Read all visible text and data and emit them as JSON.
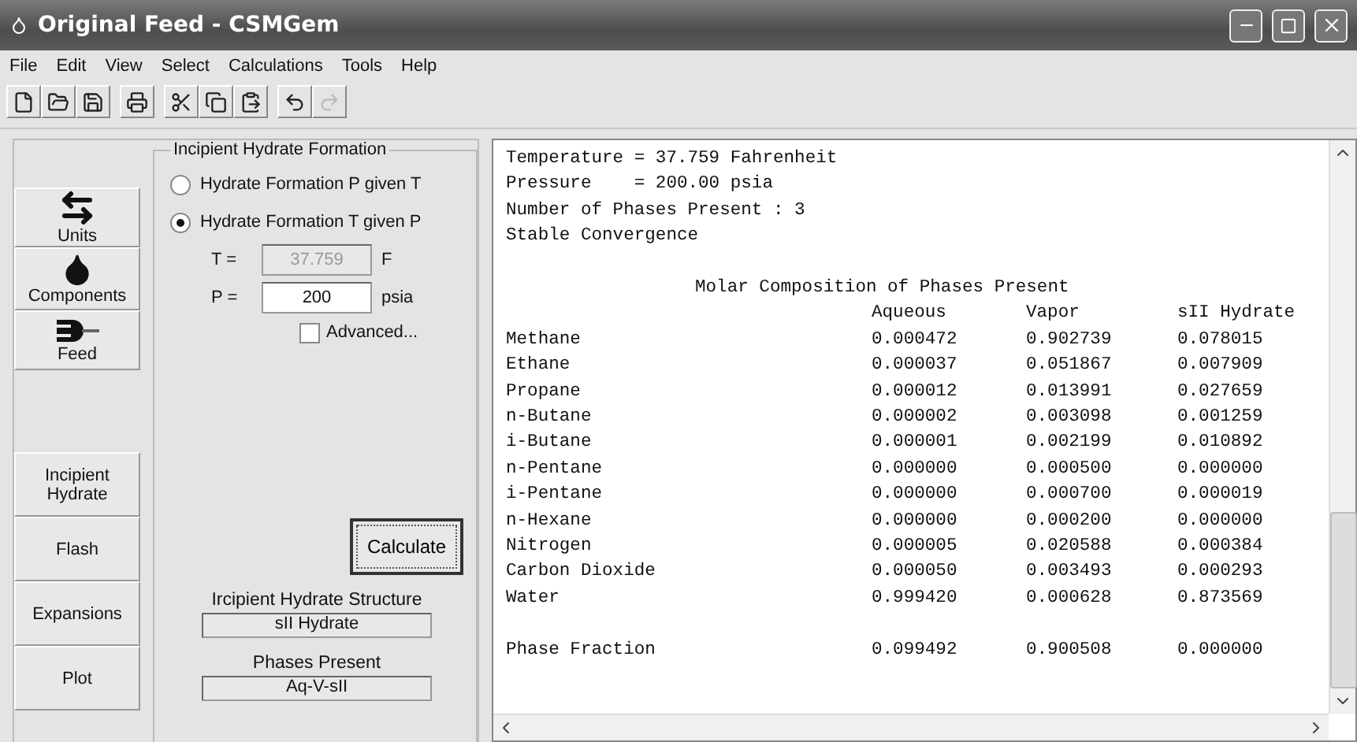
{
  "window": {
    "title": "Original Feed - CSMGem"
  },
  "menu": [
    "File",
    "Edit",
    "View",
    "Select",
    "Calculations",
    "Tools",
    "Help"
  ],
  "toolbar": [
    [
      {
        "kind": "new",
        "disabled": false
      },
      {
        "kind": "open",
        "disabled": false
      },
      {
        "kind": "save",
        "disabled": false
      }
    ],
    [
      {
        "kind": "print",
        "disabled": false
      }
    ],
    [
      {
        "kind": "cut",
        "disabled": false
      },
      {
        "kind": "copy",
        "disabled": false
      },
      {
        "kind": "paste",
        "disabled": false
      }
    ],
    [
      {
        "kind": "undo",
        "disabled": false
      },
      {
        "kind": "redo",
        "disabled": true
      }
    ]
  ],
  "nav_top": [
    {
      "kind": "units",
      "label": "Units"
    },
    {
      "kind": "components",
      "label": "Components"
    },
    {
      "kind": "feed",
      "label": "Feed"
    }
  ],
  "nav_bottom": [
    "Incipient Hydrate",
    "Flash",
    "Expansions",
    "Plot"
  ],
  "group": {
    "title": "Incipient Hydrate Formation",
    "options": [
      {
        "label": "Hydrate Formation P given T",
        "selected": false
      },
      {
        "label": "Hydrate Formation T given P",
        "selected": true
      }
    ],
    "fields": [
      {
        "label": "T =",
        "value": "37.759",
        "unit": "F",
        "disabled": true
      },
      {
        "label": "P =",
        "value": "200",
        "unit": "psia",
        "disabled": false
      }
    ],
    "advanced": {
      "label": "Advanced...",
      "checked": false
    },
    "calculate": "Calculate",
    "structure_label": "Ircipient Hydrate Structure",
    "structure_value": "sII Hydrate",
    "phases_label": "Phases Present",
    "phases_value": "Aq-V-sII"
  },
  "output": {
    "header_lines": [
      "Temperature = 37.759 Fahrenheit",
      "Pressure    = 200.00 psia",
      "Number of Phases Present : 3",
      "Stable Convergence"
    ],
    "table_title": "Molar Composition of Phases Present",
    "columns": [
      "Aqueous",
      "Vapor",
      "sII Hydrate"
    ],
    "rows": [
      {
        "name": "Methane",
        "values": [
          "0.000472",
          "0.902739",
          "0.078015"
        ]
      },
      {
        "name": "Ethane",
        "values": [
          "0.000037",
          "0.051867",
          "0.007909"
        ]
      },
      {
        "name": "Propane",
        "values": [
          "0.000012",
          "0.013991",
          "0.027659"
        ]
      },
      {
        "name": "n-Butane",
        "values": [
          "0.000002",
          "0.003098",
          "0.001259"
        ]
      },
      {
        "name": "i-Butane",
        "values": [
          "0.000001",
          "0.002199",
          "0.010892"
        ]
      },
      {
        "name": "n-Pentane",
        "values": [
          "0.000000",
          "0.000500",
          "0.000000"
        ]
      },
      {
        "name": "i-Pentane",
        "values": [
          "0.000000",
          "0.000700",
          "0.000019"
        ]
      },
      {
        "name": "n-Hexane",
        "values": [
          "0.000000",
          "0.000200",
          "0.000000"
        ]
      },
      {
        "name": "Nitrogen",
        "values": [
          "0.000005",
          "0.020588",
          "0.000384"
        ]
      },
      {
        "name": "Carbon Dioxide",
        "values": [
          "0.000050",
          "0.003493",
          "0.000293"
        ]
      },
      {
        "name": "Water",
        "values": [
          "0.999420",
          "0.000628",
          "0.873569"
        ]
      }
    ],
    "summary": {
      "name": "Phase Fraction",
      "values": [
        "0.099492",
        "0.900508",
        "0.000000"
      ]
    }
  }
}
